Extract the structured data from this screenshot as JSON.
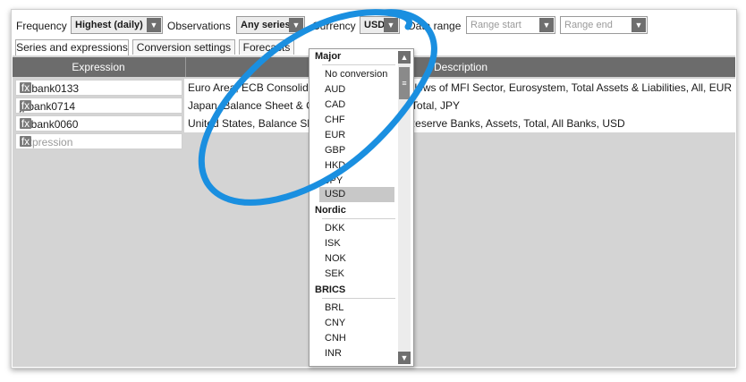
{
  "toolbar": {
    "frequency_label": "Frequency",
    "frequency_value": "Highest (daily)",
    "observations_label": "Observations",
    "observations_value": "Any series",
    "currency_label": "Currency",
    "currency_value": "USD",
    "data_range_label": "Data range",
    "range_start_placeholder": "Range start",
    "range_end_placeholder": "Range end"
  },
  "tabs": [
    {
      "label": "Series and expressions"
    },
    {
      "label": "Conversion settings"
    },
    {
      "label": "Forecasts"
    }
  ],
  "grid": {
    "col_expression": "Expression",
    "col_description": "Description",
    "rows": [
      {
        "expression": "eubank0133",
        "description": "Euro Area, ECB Consolidated Balance Sheet, Flows of MFI Sector, Eurosystem, Total Assets & Liabilities, All, EUR"
      },
      {
        "expression": "jpbank0714",
        "description": "Japan, Balance Sheet & Central Bank, Assets, Total, JPY"
      },
      {
        "expression": "usbank0060",
        "description": "United States, Balance Sheet, Sector Federal Reserve Banks, Assets, Total, All Banks, USD"
      }
    ],
    "new_row_placeholder": "Expression",
    "fx_label": "fx"
  },
  "currency_dropdown": {
    "groups": [
      {
        "name": "Major",
        "items": [
          "No conversion",
          "AUD",
          "CAD",
          "CHF",
          "EUR",
          "GBP",
          "HKD",
          "JPY",
          "USD"
        ]
      },
      {
        "name": "Nordic",
        "items": [
          "DKK",
          "ISK",
          "NOK",
          "SEK"
        ]
      },
      {
        "name": "BRICS",
        "items": [
          "BRL",
          "CNY",
          "CNH",
          "INR"
        ]
      }
    ],
    "selected": "USD"
  },
  "colors": {
    "annotation": "#1a8fe0",
    "header_bg": "#6c6c6c",
    "panel_bg": "#d4d4d4"
  }
}
